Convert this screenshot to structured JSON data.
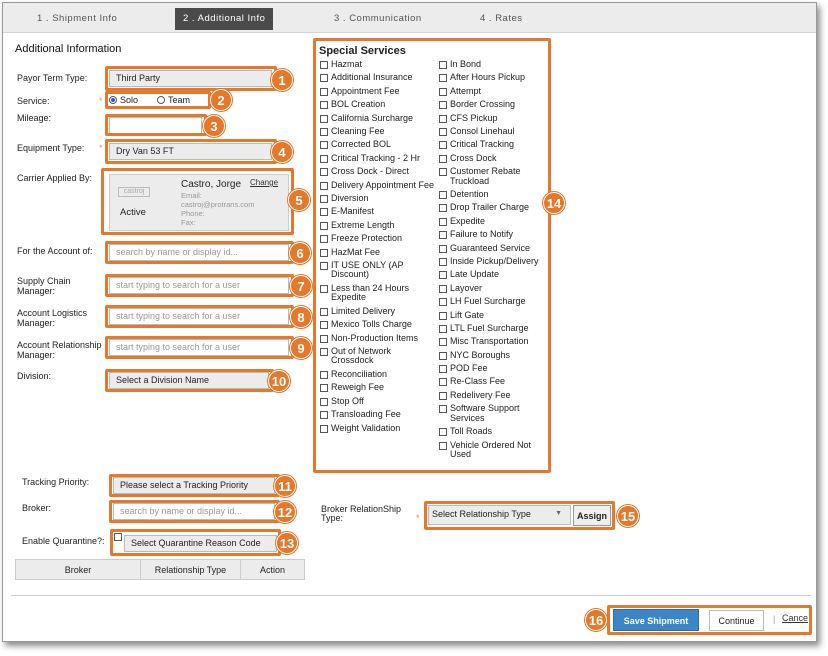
{
  "tabs": [
    {
      "label": "1 . Shipment Info"
    },
    {
      "label": "2 . Additional Info"
    },
    {
      "label": "3 . Communication"
    },
    {
      "label": "4 . Rates"
    }
  ],
  "section_title": "Additional Information",
  "payor": {
    "label": "Payor Term Type:",
    "value": "Third Party"
  },
  "service": {
    "label": "Service:",
    "opt1": "Solo",
    "opt2": "Team"
  },
  "mileage": {
    "label": "Mileage:"
  },
  "equipment": {
    "label": "Equipment Type:",
    "value": "Dry Van 53 FT"
  },
  "carrier": {
    "label": "Carrier Applied By:",
    "avatar_text": "castroj",
    "status": "Active",
    "name": "Castro, Jorge",
    "change": "Change",
    "email_label": "Email:",
    "email": "castroj@protrans.com",
    "phone_label": "Phone:",
    "fax_label": "Fax:"
  },
  "account_of": {
    "label": "For the Account of:",
    "placeholder": "search by name or display id..."
  },
  "supply_chain": {
    "label1": "Supply Chain",
    "label2": "Manager:",
    "placeholder": "start typing to search for a user"
  },
  "logistics": {
    "label1": "Account Logistics",
    "label2": "Manager:",
    "placeholder": "start typing to search for a user"
  },
  "relationship_mgr": {
    "label1": "Account Relationship",
    "label2": "Manager:",
    "placeholder": "start typing to search for a user"
  },
  "division": {
    "label": "Division:",
    "value": "Select a Division Name"
  },
  "tracking": {
    "label": "Tracking Priority:",
    "value": "Please select a Tracking Priority"
  },
  "broker": {
    "label": "Broker:",
    "placeholder": "search by name or display id..."
  },
  "quarantine": {
    "label": "Enable Quarantine?:",
    "value": "Select Quarantine Reason Code"
  },
  "table": {
    "headers": [
      "Broker",
      "Relationship Type",
      "Action"
    ]
  },
  "special": {
    "title": "Special Services",
    "col1": [
      "Hazmat",
      "Additional Insurance",
      "Appointment Fee",
      "BOL Creation",
      "California Surcharge",
      "Cleaning Fee",
      "Corrected BOL",
      "Critical Tracking - 2 Hr",
      "Cross Dock - Direct",
      "Delivery Appointment Fee",
      "Diversion",
      "E-Manifest",
      "Extreme Length",
      "Freeze Protection",
      "HazMat Fee",
      "IT USE ONLY (AP Discount)",
      "Less than 24 Hours Expedite",
      "Limited Delivery",
      "Mexico Tolls Charge",
      "Non-Production Items",
      "Out of Network Crossdock",
      "Reconciliation",
      "Reweigh Fee",
      "Stop Off",
      "Transloading Fee",
      "Weight Validation"
    ],
    "col2": [
      "In Bond",
      "After Hours Pickup",
      "Attempt",
      "Border Crossing",
      "CFS Pickup",
      "Consol Linehaul",
      "Critical Tracking",
      "Cross Dock",
      "Customer Rebate Truckload",
      "Detention",
      "Drop Trailer Charge",
      "Expedite",
      "Failure to Notify",
      "Guaranteed Service",
      "Inside Pickup/Delivery",
      "Late Update",
      "Layover",
      "LH Fuel Surcharge",
      "Lift Gate",
      "LTL Fuel Surcharge",
      "Misc Transportation",
      "NYC Boroughs",
      "POD Fee",
      "Re-Class Fee",
      "Redelivery Fee",
      "Software Support Services",
      "Toll Roads",
      "Vehicle Ordered Not Used"
    ]
  },
  "broker_rel": {
    "label1": "Broker RelationShip",
    "label2": "Type:",
    "value": "Select Relationship Type",
    "assign": "Assign"
  },
  "footer": {
    "save": "Save Shipment",
    "continue": "Continue",
    "cancel": "Cance"
  },
  "badges": [
    "1",
    "2",
    "3",
    "4",
    "5",
    "6",
    "7",
    "8",
    "9",
    "10",
    "11",
    "12",
    "13",
    "14",
    "15",
    "16"
  ],
  "colors": {
    "accent": "#e5782a",
    "primary_button": "#3a86c8"
  }
}
